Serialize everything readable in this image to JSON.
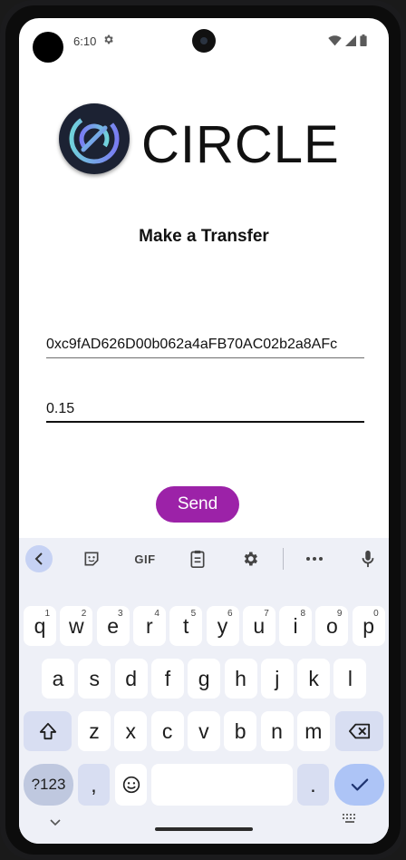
{
  "status_bar": {
    "time": "6:10"
  },
  "app": {
    "brand_name": "CIRCLE",
    "heading": "Make a Transfer",
    "address_value": "0xc9fAD626D00b062a4aFB70AC02b2a8AFc",
    "amount_value": "0.15",
    "send_label": "Send",
    "colors": {
      "send_button": "#9c22a8",
      "logo_bg": "#1c2233"
    }
  },
  "keyboard": {
    "toolbar": {
      "gif_label": "GIF"
    },
    "row1": [
      {
        "label": "q",
        "hint": "1"
      },
      {
        "label": "w",
        "hint": "2"
      },
      {
        "label": "e",
        "hint": "3"
      },
      {
        "label": "r",
        "hint": "4"
      },
      {
        "label": "t",
        "hint": "5"
      },
      {
        "label": "y",
        "hint": "6"
      },
      {
        "label": "u",
        "hint": "7"
      },
      {
        "label": "i",
        "hint": "8"
      },
      {
        "label": "o",
        "hint": "9"
      },
      {
        "label": "p",
        "hint": "0"
      }
    ],
    "row2": [
      "a",
      "s",
      "d",
      "f",
      "g",
      "h",
      "j",
      "k",
      "l"
    ],
    "row3": [
      "z",
      "x",
      "c",
      "v",
      "b",
      "n",
      "m"
    ],
    "sym_label": "?123",
    "comma_label": ",",
    "period_label": "."
  }
}
